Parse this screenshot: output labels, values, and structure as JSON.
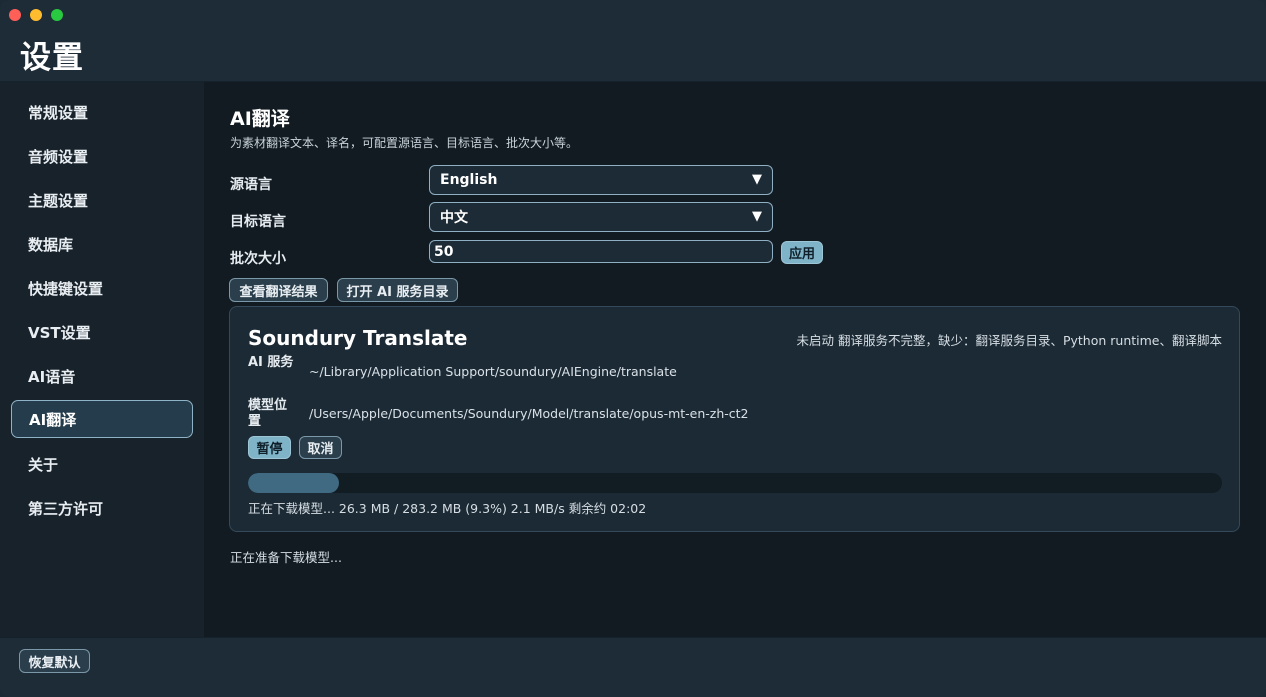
{
  "window": {
    "title": "设置"
  },
  "sidebar": {
    "items": [
      {
        "label": "常规设置"
      },
      {
        "label": "音频设置"
      },
      {
        "label": "主题设置"
      },
      {
        "label": "数据库"
      },
      {
        "label": "快捷键设置"
      },
      {
        "label": "VST设置"
      },
      {
        "label": "AI语音"
      },
      {
        "label": "AI翻译",
        "active": true
      },
      {
        "label": "关于"
      },
      {
        "label": "第三方许可"
      }
    ]
  },
  "main": {
    "title": "AI翻译",
    "description": "为素材翻译文本、译名，可配置源语言、目标语言、批次大小等。",
    "source_language": {
      "label": "源语言",
      "value": "English"
    },
    "target_language": {
      "label": "目标语言",
      "value": "中文"
    },
    "batch_size": {
      "label": "批次大小",
      "value": "50",
      "apply_label": "应用"
    },
    "view_results_label": "查看翻译结果",
    "open_dir_label": "打开 AI 服务目录",
    "card": {
      "title": "Soundury Translate",
      "status": "未启动 翻译服务不完整，缺少：翻译服务目录、Python runtime、翻译脚本",
      "service_label": "AI 服务",
      "service_path": "~/Library/Application Support/soundury/AIEngine/translate",
      "model_label": "模型位置",
      "model_path": "/Users/Apple/Documents/Soundury/Model/translate/opus-mt-en-zh-ct2",
      "pause_label": "暂停",
      "cancel_label": "取消",
      "progress_percent": 9.3,
      "progress_text": "正在下载模型...  26.3 MB / 283.2 MB (9.3%)  2.1 MB/s  剩余约 02:02"
    },
    "footer_status": "正在准备下载模型..."
  },
  "bottom": {
    "restore_label": "恢复默认"
  },
  "icons": {
    "dropdown": "triangle-down"
  },
  "colors": {
    "accent": "#7fb3c8",
    "progress": "#3f6a82"
  }
}
